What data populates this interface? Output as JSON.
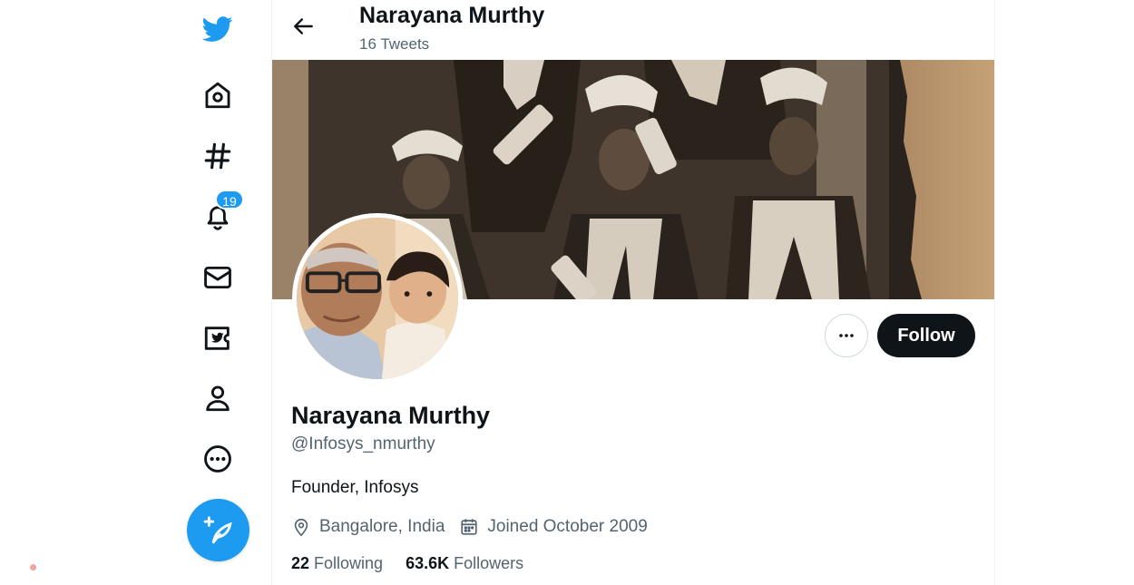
{
  "colors": {
    "accent": "#1d9bf0",
    "text": "#0f1419",
    "muted": "#536471",
    "follow_bg": "#0f1419"
  },
  "nav": {
    "items": [
      {
        "icon": "twitter-logo-icon"
      },
      {
        "icon": "home-icon"
      },
      {
        "icon": "hashtag-icon"
      },
      {
        "icon": "bell-icon",
        "badge": "19"
      },
      {
        "icon": "mail-icon"
      },
      {
        "icon": "twitter-blue-icon"
      },
      {
        "icon": "person-icon"
      },
      {
        "icon": "more-circle-icon"
      }
    ],
    "compose_icon": "feather-plus-icon"
  },
  "header": {
    "title": "Narayana Murthy",
    "subtitle": "16 Tweets",
    "back_icon": "arrow-left-icon"
  },
  "profile": {
    "name": "Narayana Murthy",
    "handle": "@Infosys_nmurthy",
    "bio": "Founder, Infosys",
    "location": "Bangalore, India",
    "joined": "Joined October 2009",
    "following_count": "22",
    "following_label": "Following",
    "followers_count": "63.6K",
    "followers_label": "Followers"
  },
  "actions": {
    "more_icon": "ellipsis-icon",
    "follow_label": "Follow"
  }
}
